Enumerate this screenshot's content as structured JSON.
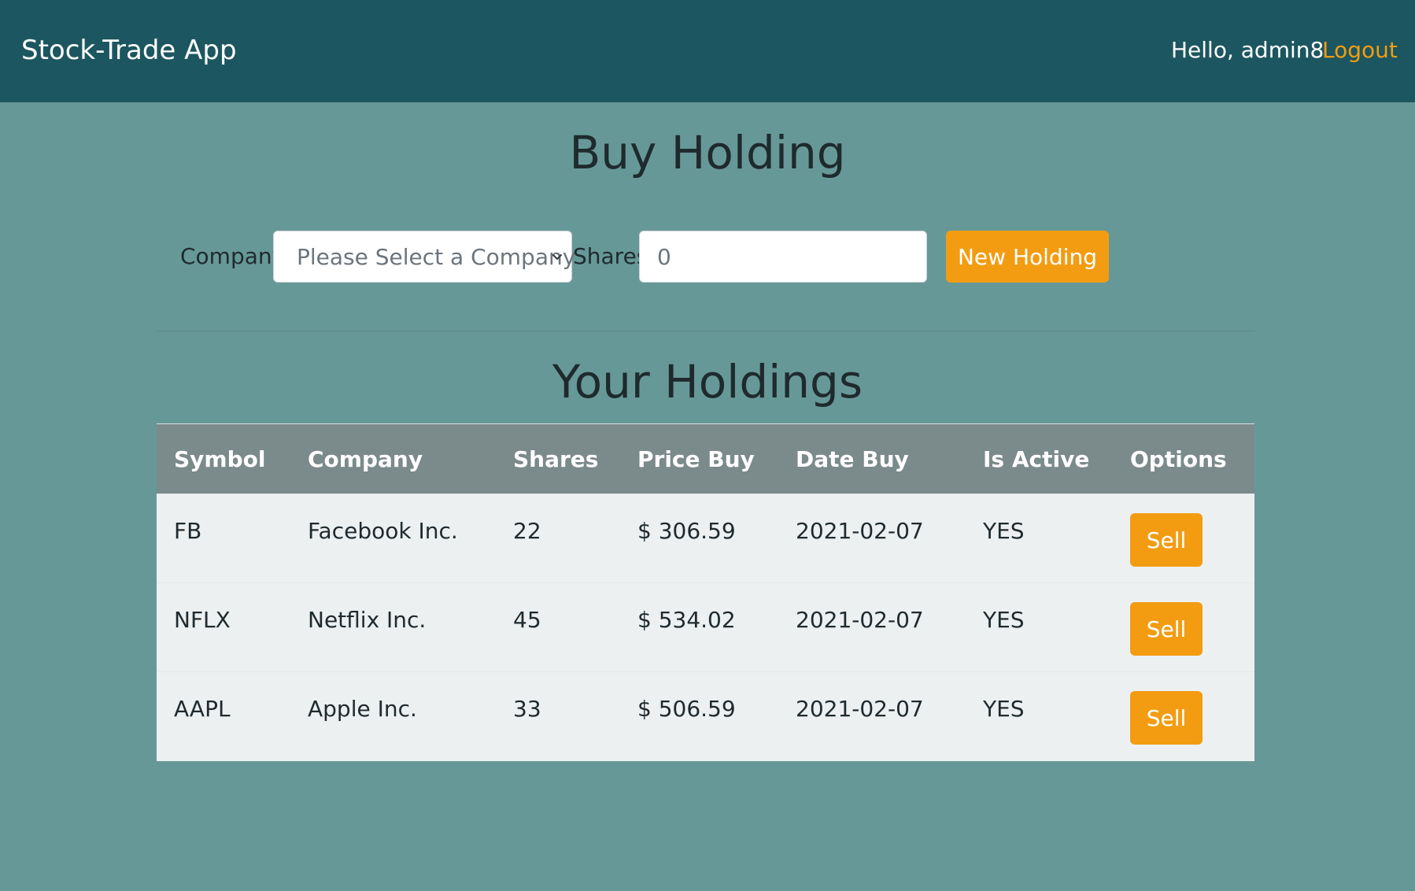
{
  "navbar": {
    "brand": "Stock-Trade App",
    "greeting": "Hello, admin8",
    "logout_label": "Logout"
  },
  "buy": {
    "title": "Buy Holding",
    "company_label": "Company",
    "company_select_value": "Please Select a Company",
    "shares_label": "Shares",
    "shares_placeholder": "0",
    "submit_label": "New Holding"
  },
  "holdings": {
    "title": "Your Holdings",
    "columns": [
      "Symbol",
      "Company",
      "Shares",
      "Price Buy",
      "Date Buy",
      "Is Active",
      "Options"
    ],
    "rows": [
      {
        "symbol": "FB",
        "company": "Facebook Inc.",
        "shares": "22",
        "price_buy": "$ 306.59",
        "date_buy": "2021-02-07",
        "is_active": "YES",
        "action_label": "Sell"
      },
      {
        "symbol": "NFLX",
        "company": "Netflix Inc.",
        "shares": "45",
        "price_buy": "$ 534.02",
        "date_buy": "2021-02-07",
        "is_active": "YES",
        "action_label": "Sell"
      },
      {
        "symbol": "AAPL",
        "company": "Apple Inc.",
        "shares": "33",
        "price_buy": "$ 506.59",
        "date_buy": "2021-02-07",
        "is_active": "YES",
        "action_label": "Sell"
      }
    ]
  },
  "icons": {
    "select_arrow": "chevron-down-icon"
  },
  "colors": {
    "navbar_bg": "#1c5660",
    "page_bg": "#679898",
    "accent": "#f39c12",
    "table_header_bg": "#7b8a8b",
    "table_row_bg": "#ecf0f1"
  }
}
